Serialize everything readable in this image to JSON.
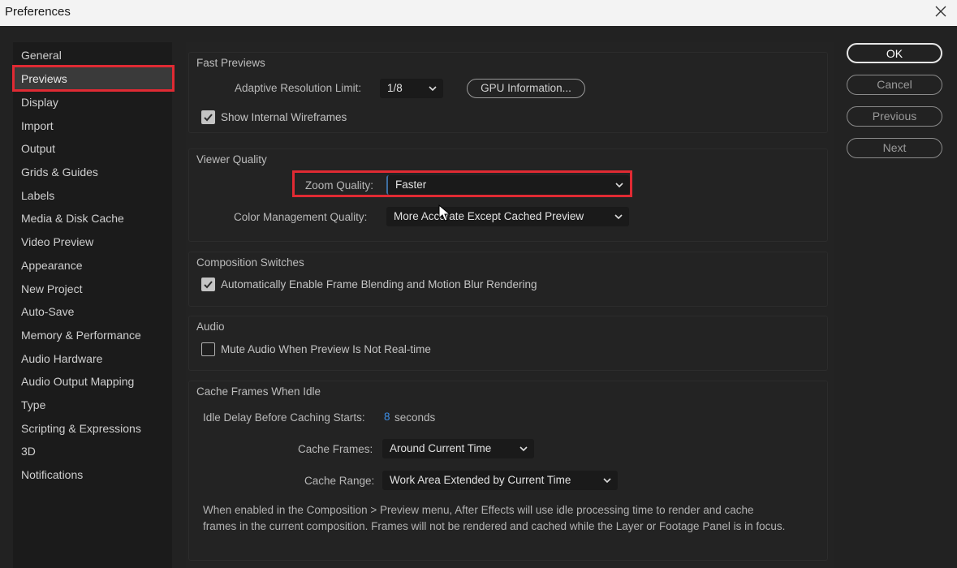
{
  "window": {
    "title": "Preferences"
  },
  "sidebar": {
    "items": [
      {
        "label": "General"
      },
      {
        "label": "Previews"
      },
      {
        "label": "Display"
      },
      {
        "label": "Import"
      },
      {
        "label": "Output"
      },
      {
        "label": "Grids & Guides"
      },
      {
        "label": "Labels"
      },
      {
        "label": "Media & Disk Cache"
      },
      {
        "label": "Video Preview"
      },
      {
        "label": "Appearance"
      },
      {
        "label": "New Project"
      },
      {
        "label": "Auto-Save"
      },
      {
        "label": "Memory & Performance"
      },
      {
        "label": "Audio Hardware"
      },
      {
        "label": "Audio Output Mapping"
      },
      {
        "label": "Type"
      },
      {
        "label": "Scripting & Expressions"
      },
      {
        "label": "3D"
      },
      {
        "label": "Notifications"
      }
    ],
    "selected": "Previews"
  },
  "fast_previews": {
    "title": "Fast Previews",
    "adaptive_label": "Adaptive Resolution Limit:",
    "adaptive_value": "1/8",
    "gpu_button": "GPU Information...",
    "wireframes_label": "Show Internal Wireframes",
    "wireframes_checked": true
  },
  "viewer_quality": {
    "title": "Viewer Quality",
    "zoom_label": "Zoom Quality:",
    "zoom_value": "Faster",
    "color_label": "Color Management Quality:",
    "color_value": "More Accurate Except Cached Preview"
  },
  "composition_switches": {
    "title": "Composition Switches",
    "blend_label": "Automatically Enable Frame Blending and Motion Blur Rendering",
    "blend_checked": true
  },
  "audio": {
    "title": "Audio",
    "mute_label": "Mute Audio When Preview Is Not Real-time",
    "mute_checked": false
  },
  "cache_idle": {
    "title": "Cache Frames When Idle",
    "delay_label": "Idle Delay Before Caching Starts:",
    "delay_value": "8",
    "delay_unit": "seconds",
    "frames_label": "Cache Frames:",
    "frames_value": "Around Current Time",
    "range_label": "Cache Range:",
    "range_value": "Work Area Extended by Current Time",
    "description": "When enabled in the Composition > Preview menu, After Effects will use idle processing time to render and cache frames in the current composition. Frames will not be rendered and cached while the Layer or Footage Panel is in focus."
  },
  "buttons": {
    "ok": "OK",
    "cancel": "Cancel",
    "previous": "Previous",
    "next": "Next"
  },
  "colors": {
    "highlight": "#e02a33",
    "accent": "#3d8fe8"
  }
}
